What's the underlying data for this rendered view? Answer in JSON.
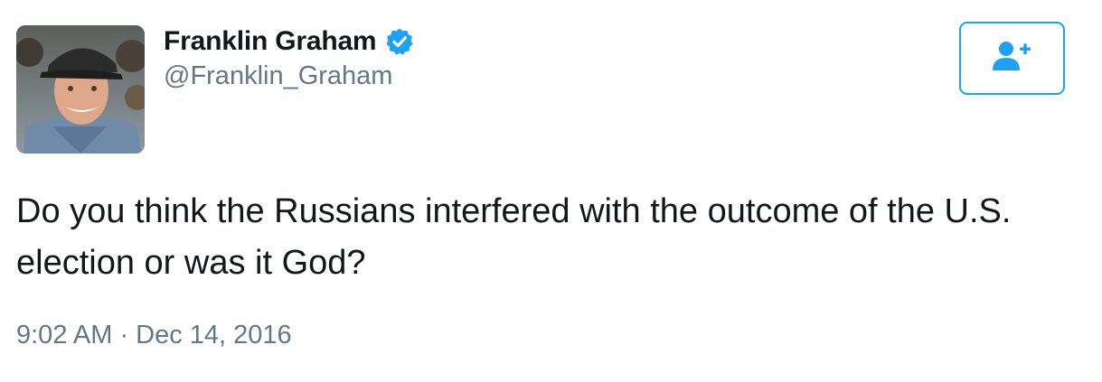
{
  "user": {
    "display_name": "Franklin Graham",
    "handle": "@Franklin_Graham",
    "verified": true
  },
  "tweet": {
    "text": "Do you think the Russians interfered with the outcome of the U.S. election or was it God?",
    "timestamp": "9:02 AM · Dec 14, 2016"
  },
  "icons": {
    "verified": "verified-badge-icon",
    "follow": "follow-user-plus-icon"
  },
  "colors": {
    "accent": "#1da1f2",
    "text": "#14171a",
    "secondary_text": "#657786"
  }
}
